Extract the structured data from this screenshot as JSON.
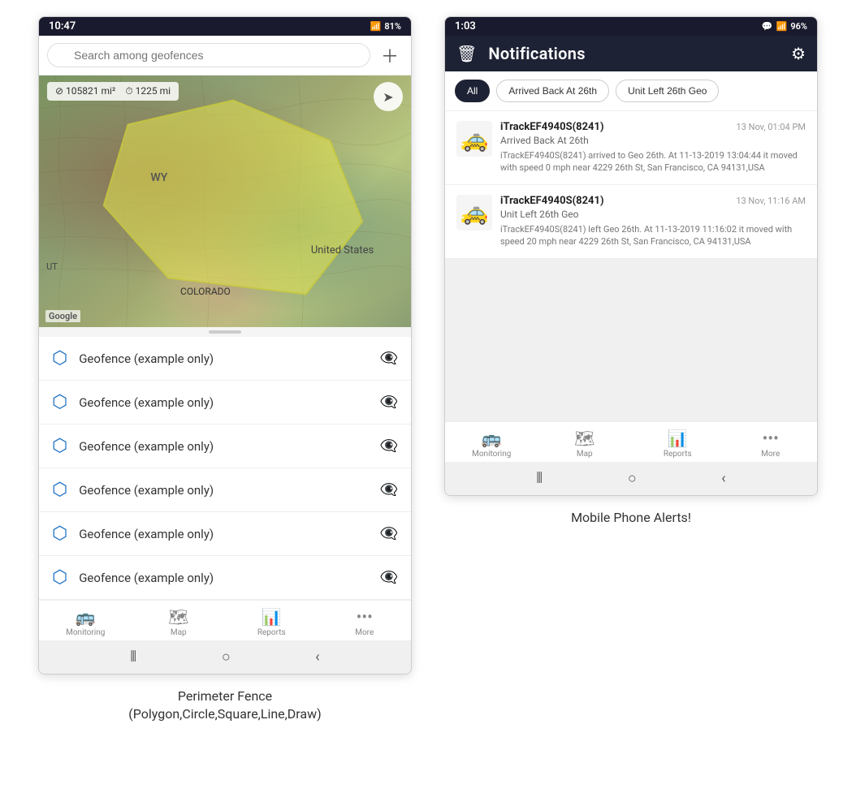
{
  "left_screen": {
    "status_bar": {
      "time": "10:47",
      "battery": "81%"
    },
    "search": {
      "placeholder": "Search among geofences"
    },
    "map": {
      "stat1": "105821 mi²",
      "stat2": "1225 mi",
      "label_wy": "WY",
      "label_us": "United States",
      "label_colorado": "COLORADO",
      "label_ut": "UT",
      "google_logo": "Google"
    },
    "geofence_items": [
      {
        "label": "Geofence (example only)"
      },
      {
        "label": "Geofence (example only)"
      },
      {
        "label": "Geofence (example only)"
      },
      {
        "label": "Geofence (example only)"
      },
      {
        "label": "Geofence (example only)"
      },
      {
        "label": "Geofence (example only)"
      }
    ],
    "bottom_nav": [
      {
        "label": "Monitoring",
        "icon": "🚌"
      },
      {
        "label": "Map",
        "icon": "🗺"
      },
      {
        "label": "Reports",
        "icon": "📊"
      },
      {
        "label": "More",
        "icon": "···"
      }
    ],
    "caption": "Perimeter Fence\n(Polygon,Circle,Square,Line,Draw)"
  },
  "right_screen": {
    "status_bar": {
      "time": "1:03",
      "battery": "96%"
    },
    "header": {
      "title": "Notifications"
    },
    "filters": [
      {
        "label": "All",
        "active": true
      },
      {
        "label": "Arrived Back At 26th",
        "active": false
      },
      {
        "label": "Unit Left 26th Geo",
        "active": false
      }
    ],
    "notifications": [
      {
        "device": "iTrackEF4940S(8241)",
        "time": "13 Nov, 01:04 PM",
        "event": "Arrived Back At 26th",
        "desc": "iTrackEF4940S(8241) arrived to Geo 26th.   At 11-13-2019 13:04:44 it moved with speed 0 mph near 4229 26th St, San Francisco, CA 94131,USA",
        "car_color": "yellow"
      },
      {
        "device": "iTrackEF4940S(8241)",
        "time": "13 Nov, 11:16 AM",
        "event": "Unit Left 26th Geo",
        "desc": "iTrackEF4940S(8241) left Geo 26th.   At 11-13-2019 11:16:02 it moved with speed 20 mph near 4229 26th St, San Francisco, CA 94131,USA",
        "car_color": "yellow"
      }
    ],
    "bottom_nav": [
      {
        "label": "Monitoring",
        "icon": "🚌"
      },
      {
        "label": "Map",
        "icon": "🗺"
      },
      {
        "label": "Reports",
        "icon": "📊"
      },
      {
        "label": "More",
        "icon": "···"
      }
    ],
    "caption": "Mobile Phone Alerts!"
  }
}
